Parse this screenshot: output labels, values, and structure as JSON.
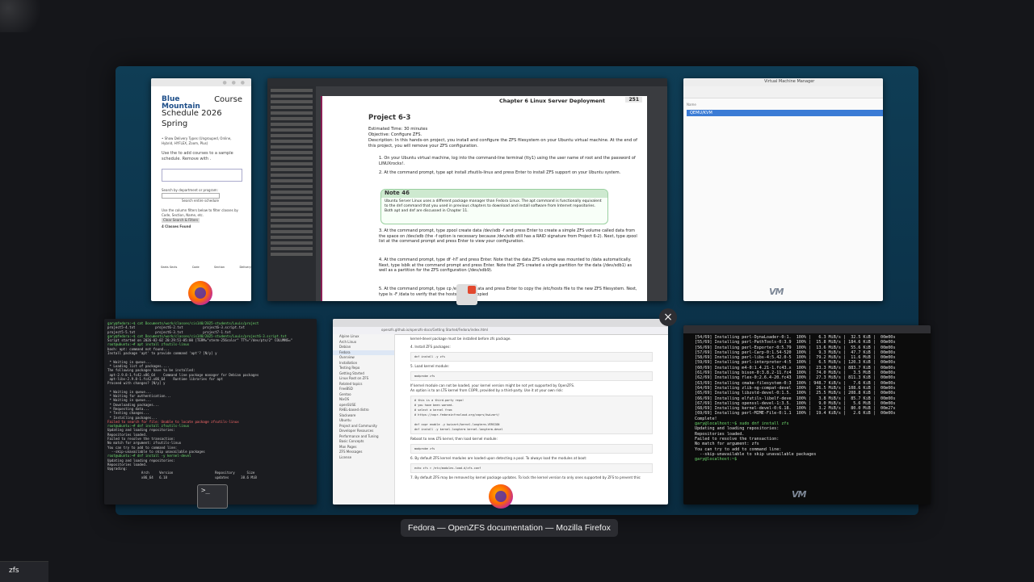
{
  "overview": {
    "caption": "Fedora — OpenZFS documentation — Mozilla Firefox",
    "close_label": "×",
    "search_text": "zfs"
  },
  "course": {
    "logo": "Blue Mountain",
    "title_right": "Course",
    "title_line2": "Schedule 2026",
    "title_line3": "Spring",
    "bullets": [
      "• Show Delivery Types (Ungrouped, Online, Hybrid, HYFLEX, Zoom, Plus)",
      "Use the to add courses to a sample schedule. Remove with ."
    ],
    "search_label": "Search by department or program:",
    "search_btn": "Search entire schedule",
    "filter_hint": "Use the column filters below to filter classes by Code, Section, Name, etc.",
    "clear_btn": "Clear Search & Filters",
    "classes_found": "4 Classes Found",
    "table_headers": [
      "Seats Sects",
      "Code",
      "Section",
      "Delivery"
    ]
  },
  "pdf": {
    "chapter": "Chapter 6   Linux Server Deployment",
    "page_number": "251",
    "project": "Project 6-3",
    "estimated": "Estimated Time: 30 minutes",
    "objective": "Objective: Configure ZFS.",
    "description": "Description: In this hands-on project, you install and configure the ZFS filesystem on your Ubuntu virtual machine. At the end of this project, you will remove your ZFS configuration.",
    "step1": "1. On your Ubuntu virtual machine, log into the command-line terminal (tty1) using the user name of root and the password of LINUXrocks!.",
    "step2": "2. At the command prompt, type apt install zfsutils-linux and press Enter to install ZFS support on your Ubuntu system.",
    "note_title": "Note 46",
    "note_body": "Ubuntu Server Linux uses a different package manager than Fedora Linux. The apt command is functionally equivalent to the dnf command that you used in previous chapters to download and install software from Internet repositories. Both apt and dnf are discussed in Chapter 11.",
    "step3": "3. At the command prompt, type zpool create data /dev/sdb -f and press Enter to create a simple ZFS volume called data from the space on /dev/sdb (the -f option is necessary because /dev/sdb still has a RAID signature from Project 6-2). Next, type zpool list at the command prompt and press Enter to view your configuration.",
    "step4": "4. At the command prompt, type df -hT and press Enter. Note that the data ZFS volume was mounted to /data automatically. Next, type lsblk at the command prompt and press Enter. Note that ZFS created a single partition for the data (/dev/sdb1) as well as a partition for the ZFS configuration (/dev/sdb9).",
    "step5": "5. At the command prompt, type cp /etc/hosts /data and press Enter to copy the /etc/hosts file to the new ZFS filesystem. Next, type ls -F /data to verify that the hosts file was copied"
  },
  "vm": {
    "title": "Virtual Machine Manager",
    "column": "Name",
    "row": "QEMU/KVM"
  },
  "terminal1": {
    "lines": [
      "gary@fedora:~$ cat Documents/work/classes/cis140/2025-students/Louis/project",
      "project5-4.txt          project6-2.txt          project6-3.script.txt",
      "project5-5.txt          project6-3.txt          project7-1.txt",
      "gary@fedora:~$ cat Documents/work/classes/cis140/2025-students/Louis/project6-3.script.txt",
      "Script started on 2026-02-02 20:29:51-05:00 [TERM=\"xterm-256color\" TTY=\"/dev/pts/2\" COLUMNS=\"",
      "root@ubuntu:~# apt install zfsutils-linux",
      "bash: apt: command not found...",
      "Install package 'apt' to provide command 'apt'? [N/y] y",
      "",
      " * Waiting in queue...",
      " * Loading list of packages....",
      "The following packages have to be installed:",
      " apt-2.9.8-1.fc42.x86_64    Command line package manager for Debian packages",
      " apt-libs-2.9.8-1.fc42.x86_64    Runtime libraries for apt",
      "Proceed with changes? [N/y] y",
      "",
      " * Waiting in queue...",
      " * Waiting for authentication...",
      " * Waiting in queue...",
      " * Downloading packages...",
      " * Requesting data...",
      " * Testing changes...",
      " * Installing packages...",
      "Failed to search for file: Unable to locate package zfsutils-linux",
      "root@ubuntu:~# dnf install zfsutils-linux",
      "Updating and loading repositories:",
      "Repositories loaded.",
      "Failed to resolve the transaction:",
      "No match for argument: zfsutils-linux",
      "You can try to add to command line:",
      "  --skip-unavailable to skip unavailable packages",
      "root@ubuntu:~# dnf install -y kernel-devel",
      "Updating and loading repositories:",
      "Repositories loaded.",
      "Upgrading:",
      "                 Arch     Version                     Repository      Size",
      "                 x86_64   6.18                        updates      38.6 MiB"
    ]
  },
  "firefox": {
    "url": "openzfs.github.io/openzfs-docs/Getting Started/Fedora/index.html",
    "sidebar": [
      "Alpine Linux",
      "Arch Linux",
      "Debian",
      "Fedora",
      "Overview",
      "Installation",
      "Testing Repo",
      "Getting Started",
      "Linux Root on ZFS",
      "Related topics",
      "FreeBSD",
      "Gentoo",
      "NixOS",
      "openSUSE",
      "RHEL-based distro",
      "Slackware",
      "Ubuntu",
      "Project and Community",
      "Developer Resources",
      "Performance and Tuning",
      "Basic Concepts",
      "Man Pages",
      "ZFS Messages",
      "License"
    ],
    "intro": "kernel-devel package must be installed before zfs package.",
    "step4": "4. Install ZFS packages:",
    "code1": "dnf install -y zfs",
    "step5": "5. Load kernel module:",
    "code2": "modprobe zfs",
    "para1": "If kernel module can not be loaded, your kernel version might be not yet supported by OpenZFS.",
    "para2": "An option is to an LTS kernel from COPR, provided by a third-party. Use it at your own risk:",
    "code3": "# this is a third-party repo!\n# you have been warned.\n# select a kernel from\n# https://copr.fedorainfracloud.org/coprs/kwizart/\n\ndnf copr enable -y kwizart/kernel-longterm-VERSION\ndnf install -y kernel-longterm kernel-longterm-devel",
    "para3": "Reboot to new LTS kernel, then load kernel module:",
    "code4": "modprobe zfs",
    "step6": "6. By default ZFS kernel modules are loaded upon detecting a pool. To always load the modules at boot:",
    "code5": "echo zfs > /etc/modules-load.d/zfs.conf",
    "step7": "7. By default ZFS may be removed by kernel package updates. To lock the kernel version to only ones supported by ZFS to prevent this:"
  },
  "terminal2": {
    "lines": [
      "[54/69] Installing perl-DynaLoader-0:1.  100% |   6.3 MiB/s |  32.5 KiB |  00m00s",
      "[55/69] Installing perl-PathTools-0:3.9  100% |  15.8 MiB/s | 184.6 KiB |  00m00s",
      "[56/69] Installing perl-Exporter-0:5.79  100% |  13.6 MiB/s |  55.6 KiB |  00m00s",
      "[57/69] Installing perl-Carp-0:1.54-520  100% |   9.3 MiB/s |  47.7 KiB |  00m00s",
      "[58/69] Installing perl-libs-4:5.42.0-5  100% |  79.2 MiB/s |  11.6 MiB |  00m00s",
      "[59/69] Installing perl-interpreter-4:5  100% |   6.5 MiB/s | 120.3 KiB |  00m00s",
      "[60/69] Installing m4-0:1.4.21-1.fc43.x  100% |  23.3 MiB/s | 883.7 KiB |  00m00s",
      "[61/69] Installing bison-0:3.8.2-11.fc4  100% |  74.0 MiB/s |   3.5 MiB |  00m00s",
      "[62/69] Installing flex-0:2.6.4-20.fc43  100% |  27.3 MiB/s | 811.3 KiB |  00m00s",
      "[63/69] Installing cmake-filesystem-0:3  100% | 948.7 KiB/s |   7.6 KiB |  00m00s",
      "[64/69] Installing zlib-ng-compat-devel  100% |  26.5 MiB/s | 108.6 KiB |  00m00s",
      "[65/69] Installing libzstd-devel-0:1.5.  100% |  25.5 MiB/s | 208.8 KiB |  00m00s",
      "[66/69] Installing elfutils-libelf-deve  100% |   3.8 MiB/s |  85.7 KiB |  00m00s",
      "[67/69] Installing openssl-devel-1:3.5.  100% |   9.0 MiB/s |   5.6 MiB |  00m00s",
      "[68/69] Installing kernel-devel-0:6.18.  100% |   3.2 MiB/s |  80.0 MiB |  00m27s",
      "[69/69] Installing perl-MIME-File-0:1.1  100% |  19.4 KiB/s |   2.6 KiB |  00m00s",
      "Complete!",
      "gary@localhost:~$ sudo dnf install zfs",
      "Updating and loading repositories:",
      "Repositories loaded.",
      "Failed to resolve the transaction:",
      "No match for argument: zfs",
      "You can try to add to command line:",
      "  --skip-unavailable to skip unavailable packages",
      "gary@localhost:~$"
    ]
  },
  "watermark": "VM",
  "term_icon_glyph": ">_"
}
